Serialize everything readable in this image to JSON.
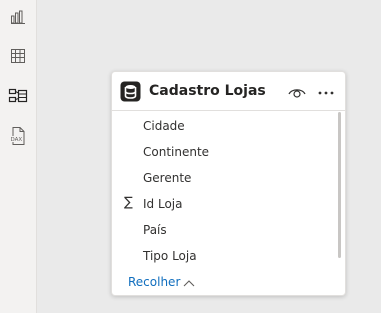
{
  "rail": {
    "items": [
      {
        "icon": "report-view-icon"
      },
      {
        "icon": "table-view-icon"
      },
      {
        "icon": "model-view-icon",
        "active": true
      },
      {
        "icon": "dax-query-view-icon",
        "label": "DAX"
      }
    ]
  },
  "card": {
    "title": "Cadastro Lojas",
    "icon": "database-table-icon",
    "fields": [
      {
        "label": "Cidade",
        "sum": false
      },
      {
        "label": "Continente",
        "sum": false
      },
      {
        "label": "Gerente",
        "sum": false
      },
      {
        "label": "Id Loja",
        "sum": true
      },
      {
        "label": "País",
        "sum": false
      },
      {
        "label": "Tipo Loja",
        "sum": false
      }
    ],
    "sigma": "∑",
    "collapse_label": "Recolher",
    "more_label": "···"
  },
  "colors": {
    "accent": "#106ebe",
    "active_icon": "#252423",
    "inactive_icon": "#605e5c"
  }
}
